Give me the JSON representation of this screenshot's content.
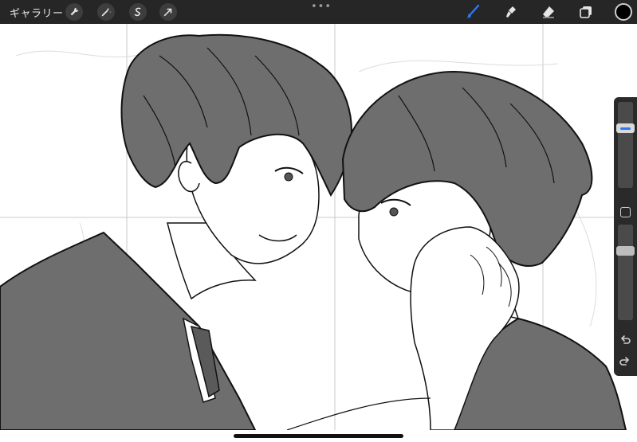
{
  "toolbar": {
    "gallery_label": "ギャラリー",
    "left_tools": [
      {
        "name": "wrench-icon"
      },
      {
        "name": "magic-wand-icon"
      },
      {
        "name": "selection-icon"
      },
      {
        "name": "transform-arrow-icon"
      }
    ],
    "center_dots": "•••",
    "right_tools": [
      {
        "name": "brush-icon",
        "active": true
      },
      {
        "name": "smudge-icon"
      },
      {
        "name": "eraser-icon"
      },
      {
        "name": "layers-icon"
      }
    ],
    "current_color": "#000000"
  },
  "sidebar": {
    "brush_size_level": 0.72,
    "opacity_level": 0.75,
    "icons": [
      "undo-icon",
      "redo-icon"
    ]
  },
  "colors": {
    "toolbar_bg": "#262626",
    "accent": "#2b79f5",
    "fill_gray": "#6e6e6e",
    "line": "#111111"
  }
}
